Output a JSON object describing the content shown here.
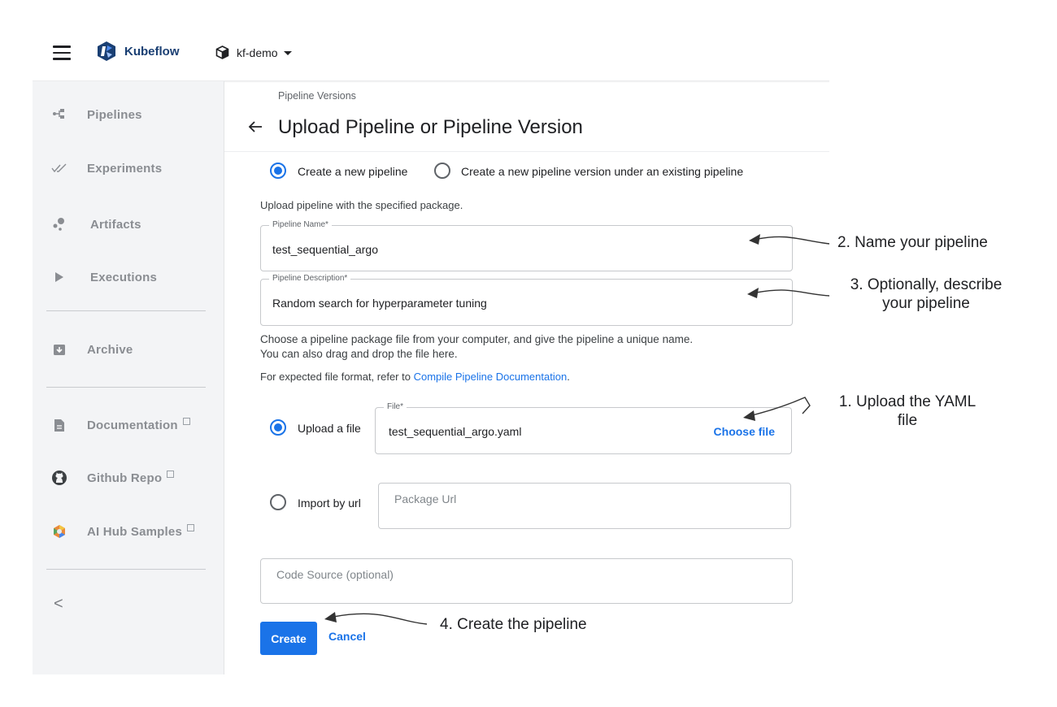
{
  "header": {
    "app_name": "Kubeflow",
    "namespace": "kf-demo"
  },
  "sidebar": {
    "items": [
      {
        "label": "Pipelines",
        "icon": "pipelines-icon"
      },
      {
        "label": "Experiments",
        "icon": "experiments-icon"
      },
      {
        "label": "Artifacts",
        "icon": "artifacts-icon"
      },
      {
        "label": "Executions",
        "icon": "executions-icon"
      },
      {
        "label": "Archive",
        "icon": "archive-icon"
      },
      {
        "label": "Documentation",
        "icon": "document-icon"
      },
      {
        "label": "Github Repo",
        "icon": "github-icon"
      },
      {
        "label": "AI Hub Samples",
        "icon": "ai-hub-icon"
      }
    ],
    "collapse_glyph": "<"
  },
  "page": {
    "breadcrumb": "Pipeline Versions",
    "title": "Upload Pipeline or Pipeline Version"
  },
  "mode": {
    "option_new_pipeline": "Create a new pipeline",
    "option_new_version": "Create a new pipeline version under an existing pipeline",
    "selected": "new_pipeline"
  },
  "form": {
    "intro": "Upload pipeline with the specified package.",
    "name_label": "Pipeline Name*",
    "name_value": "test_sequential_argo",
    "description_label": "Pipeline Description*",
    "description_value": "Random search for hyperparameter tuning",
    "help_line1": "Choose a pipeline package file from your computer, and give the pipeline a unique name.",
    "help_line2": "You can also drag and drop the file here.",
    "format_prefix": "For expected file format, refer to ",
    "format_link": "Compile Pipeline Documentation",
    "format_suffix": ".",
    "upload_option": "Upload a file",
    "file_label": "File*",
    "file_value": "test_sequential_argo.yaml",
    "choose_file": "Choose file",
    "url_option": "Import by url",
    "url_placeholder": "Package Url",
    "code_source_placeholder": "Code Source (optional)",
    "create_button": "Create",
    "cancel_button": "Cancel"
  },
  "annotations": {
    "name": "2. Name your pipeline",
    "describe_line1": "3. Optionally, describe",
    "describe_line2": "your pipeline",
    "upload_line1": "1. Upload the YAML",
    "upload_line2": "file",
    "create": "4. Create the pipeline"
  },
  "colors": {
    "accent": "#1a73e8",
    "brand": "#1a3f73",
    "sidebar_bg": "#f3f4f6",
    "sidebar_text": "#8a8d92"
  }
}
